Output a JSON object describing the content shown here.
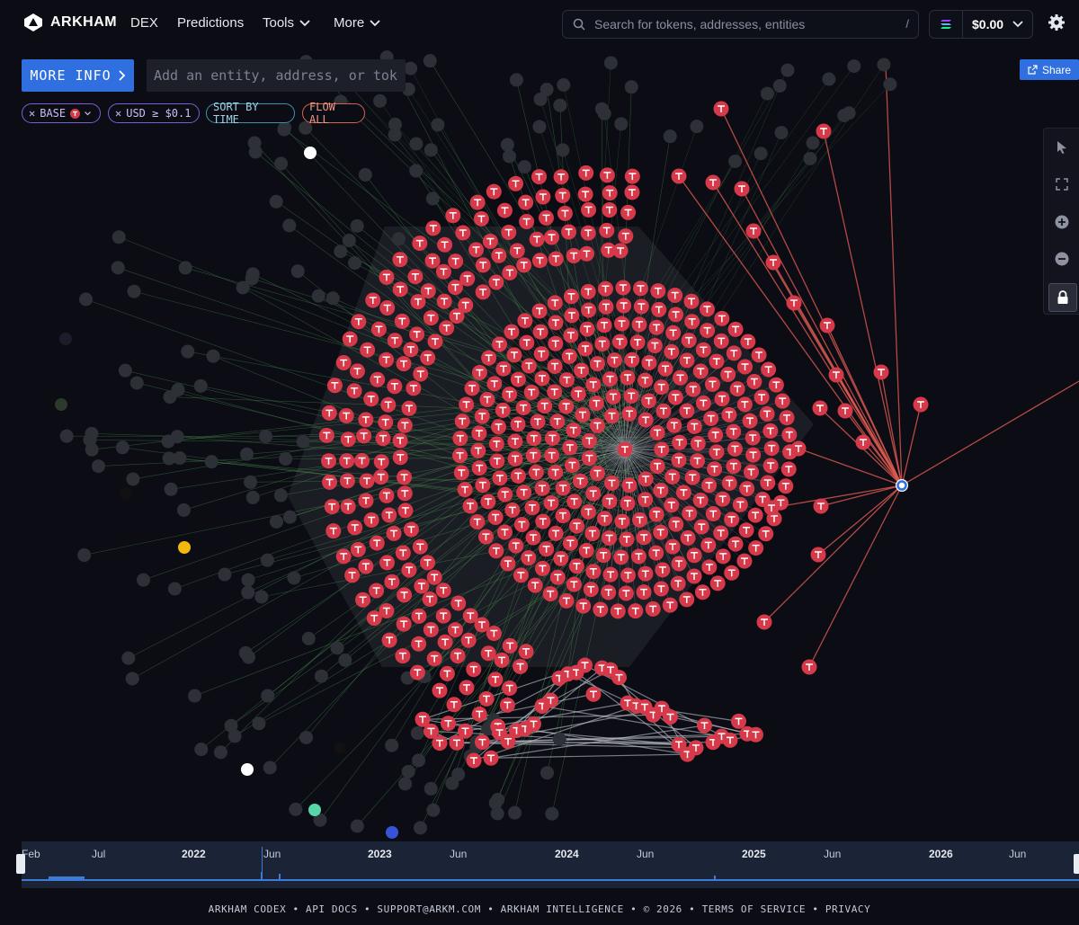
{
  "nav": {
    "brand": "ARKHAM",
    "items": [
      "DEX",
      "Predictions",
      "Tools",
      "More"
    ],
    "search_placeholder": "Search for tokens, addresses, entities",
    "search_shortcut": "/",
    "wallet_balance": "$0.00"
  },
  "toolbar": {
    "more_info_label": "MORE INFO",
    "entity_placeholder": "Add an entity, address, or token",
    "share_label": "Share"
  },
  "filters": {
    "base": "BASE",
    "usd": "USD ≥ $0.1",
    "sort": "SORT BY TIME",
    "flow": "FLOW ALL"
  },
  "timeline": {
    "labels": [
      "Feb",
      "Jul",
      "2022",
      "Jun",
      "2023",
      "Jun",
      "2024",
      "Jun",
      "2025",
      "Jun",
      "2026",
      "Jun"
    ]
  },
  "footer": {
    "codex": "ARKHAM CODEX",
    "api": "API DOCS",
    "support": "SUPPORT@ARKM.COM",
    "intel": "ARKHAM INTELLIGENCE",
    "copyright": "© 2026",
    "terms": "TERMS OF SERVICE",
    "privacy": "PRIVACY"
  },
  "colors": {
    "accent": "#2f6fe0",
    "token_node": "#d63a4a",
    "edge_out": "#e05a50",
    "edge_in": "#4f9a4f",
    "background": "#0b0c14"
  }
}
